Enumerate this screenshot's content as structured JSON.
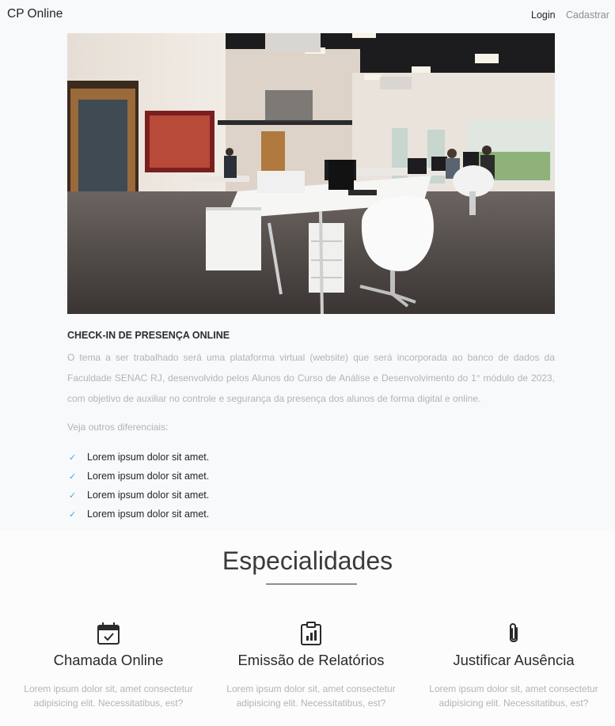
{
  "navbar": {
    "brand": "CP Online",
    "login": "Login",
    "register": "Cadastrar"
  },
  "hero": {
    "alt": "Foto de escritório"
  },
  "about": {
    "title": "CHECK-IN DE PRESENÇA ONLINE",
    "text": "O tema a ser trabalhado será uma plataforma virtual (website) que será incorporada ao banco de dados da Faculdade SENAC RJ, desenvolvido pelos Alunos do Curso de Análise e Desenvolvimento do 1° módulo de 2023, com objetivo de auxiliar no controle e segurança da presença dos alunos de forma digital e online.",
    "veja": "Veja outros diferenciais:",
    "items": [
      "Lorem ipsum dolor sit amet.",
      "Lorem ipsum dolor sit amet.",
      "Lorem ipsum dolor sit amet.",
      "Lorem ipsum dolor sit amet."
    ],
    "check_icon": "checkmark-icon",
    "check_color": "#3fa7e0"
  },
  "specialties": {
    "title": "Especialidades",
    "cards": [
      {
        "icon": "calendar-check-icon",
        "title": "Chamada Online",
        "text": "Lorem ipsum dolor sit, amet consectetur adipisicing elit. Necessitatibus, est?"
      },
      {
        "icon": "clipboard-chart-icon",
        "title": "Emissão de Relatórios",
        "text": "Lorem ipsum dolor sit, amet consectetur adipisicing elit. Necessitatibus, est?"
      },
      {
        "icon": "paperclip-icon",
        "title": "Justificar Ausência",
        "text": "Lorem ipsum dolor sit, amet consectetur adipisicing elit. Necessitatibus, est?"
      }
    ]
  }
}
